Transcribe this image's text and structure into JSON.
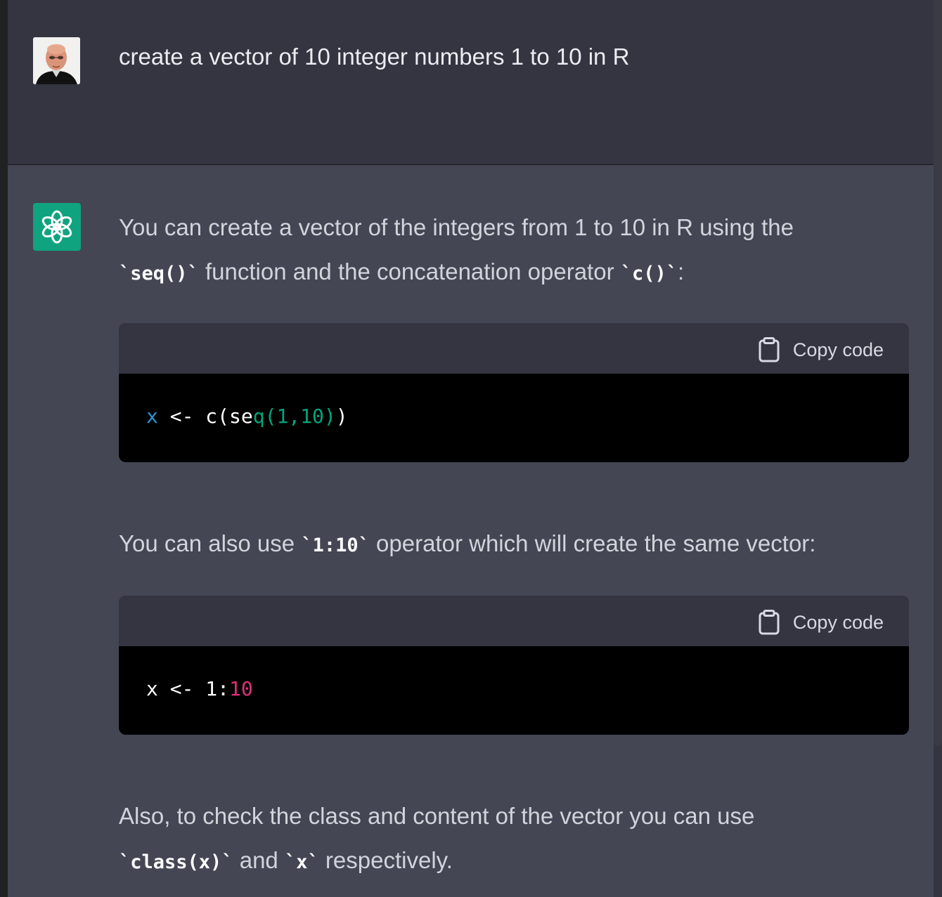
{
  "user_message": {
    "text": "create a vector of 10 integer numbers 1 to 10 in R"
  },
  "assistant_message": {
    "para1": {
      "t1": "You can create a vector of the integers from 1 to 10 in R using the",
      "c1": "`seq()`",
      "t2": " function and the concatenation operator ",
      "c2": "`c()`",
      "t3": ":"
    },
    "code_block_1": {
      "copy_label": "Copy code",
      "tokens": [
        "x",
        " <- ",
        "c(se",
        "q(1,10)",
        ")"
      ]
    },
    "para2": {
      "t1": "You can also use ",
      "c1": "`1:10`",
      "t2": " operator which will create the same vector:"
    },
    "code_block_2": {
      "copy_label": "Copy code",
      "tokens": [
        "x <- 1:",
        "10"
      ]
    },
    "para3": {
      "t1": "Also, to check the class and content of the vector you can use",
      "c1": "`class(x)`",
      "t2": " and ",
      "c2": "`x`",
      "t3": " respectively."
    }
  },
  "colors": {
    "user_bg": "#343541",
    "assistant_bg": "#444654",
    "brand_green": "#10a37f",
    "code_bg": "#000000",
    "code_header_bg": "#343541"
  },
  "icons": {
    "avatar": "user-avatar",
    "assistant": "openai-logo-icon",
    "copy": "clipboard-icon"
  }
}
